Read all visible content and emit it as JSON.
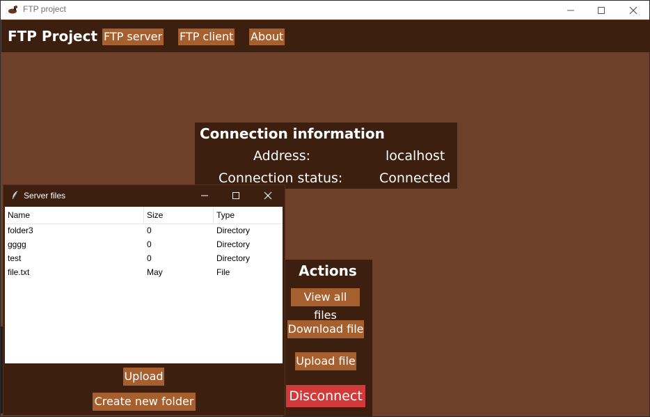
{
  "window": {
    "title": "FTP project"
  },
  "menubar": {
    "brand": "FTP Project",
    "items": [
      {
        "label": "FTP server"
      },
      {
        "label": "FTP client"
      },
      {
        "label": "About"
      }
    ]
  },
  "connection": {
    "title": "Connection information",
    "address_label": "Address:",
    "address_value": "localhost",
    "status_label": "Connection status:",
    "status_value": "Connected"
  },
  "actions": {
    "title": "Actions",
    "view_all": "View all files",
    "download": "Download file",
    "upload": "Upload file",
    "disconnect": "Disconnect"
  },
  "server_files": {
    "title": "Server files",
    "columns": [
      "Name",
      "Size",
      "Type"
    ],
    "rows": [
      [
        "folder3",
        "0",
        "Directory"
      ],
      [
        "gggg",
        "0",
        "Directory"
      ],
      [
        "test",
        "0",
        "Directory"
      ],
      [
        "file.txt",
        "May",
        "File"
      ]
    ],
    "upload_label": "Upload",
    "new_folder_label": "Create new folder"
  },
  "colors": {
    "background": "#6f4029",
    "panel": "#3c1f0f",
    "button": "#a6602f",
    "disconnect": "#d13a3a"
  }
}
